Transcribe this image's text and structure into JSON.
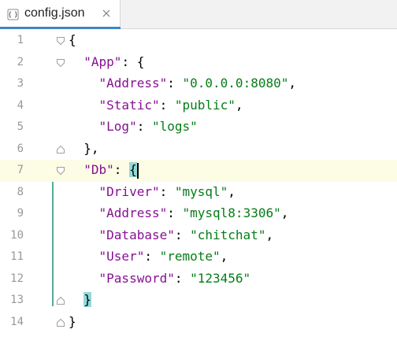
{
  "tab": {
    "title": "config.json",
    "icon": "json-file-icon",
    "close_icon": "close-icon",
    "accent": "#4083c9"
  },
  "colors": {
    "key": "#871094",
    "string": "#067d17",
    "current_line": "#fdfce5",
    "brace_highlight": "#93d9d9",
    "line_number": "#999999"
  },
  "editor": {
    "current_line": 7,
    "lines": [
      {
        "n": "1",
        "tokens": [
          {
            "t": "{",
            "c": "punc"
          }
        ]
      },
      {
        "n": "2",
        "tokens": [
          {
            "t": "  ",
            "c": "punc"
          },
          {
            "t": "\"App\"",
            "c": "key"
          },
          {
            "t": ": {",
            "c": "punc"
          }
        ]
      },
      {
        "n": "3",
        "tokens": [
          {
            "t": "    ",
            "c": "punc"
          },
          {
            "t": "\"Address\"",
            "c": "key"
          },
          {
            "t": ": ",
            "c": "punc"
          },
          {
            "t": "\"0.0.0.0:8080\"",
            "c": "str"
          },
          {
            "t": ",",
            "c": "punc"
          }
        ]
      },
      {
        "n": "4",
        "tokens": [
          {
            "t": "    ",
            "c": "punc"
          },
          {
            "t": "\"Static\"",
            "c": "key"
          },
          {
            "t": ": ",
            "c": "punc"
          },
          {
            "t": "\"public\"",
            "c": "str"
          },
          {
            "t": ",",
            "c": "punc"
          }
        ]
      },
      {
        "n": "5",
        "tokens": [
          {
            "t": "    ",
            "c": "punc"
          },
          {
            "t": "\"Log\"",
            "c": "key"
          },
          {
            "t": ": ",
            "c": "punc"
          },
          {
            "t": "\"logs\"",
            "c": "str"
          }
        ]
      },
      {
        "n": "6",
        "tokens": [
          {
            "t": "  },",
            "c": "punc"
          }
        ]
      },
      {
        "n": "7",
        "tokens": [
          {
            "t": "  ",
            "c": "punc"
          },
          {
            "t": "\"Db\"",
            "c": "key"
          },
          {
            "t": ": ",
            "c": "punc"
          },
          {
            "t": "{",
            "c": "brace"
          }
        ]
      },
      {
        "n": "8",
        "tokens": [
          {
            "t": "    ",
            "c": "punc"
          },
          {
            "t": "\"Driver\"",
            "c": "key"
          },
          {
            "t": ": ",
            "c": "punc"
          },
          {
            "t": "\"mysql\"",
            "c": "str"
          },
          {
            "t": ",",
            "c": "punc"
          }
        ]
      },
      {
        "n": "9",
        "tokens": [
          {
            "t": "    ",
            "c": "punc"
          },
          {
            "t": "\"Address\"",
            "c": "key"
          },
          {
            "t": ": ",
            "c": "punc"
          },
          {
            "t": "\"mysql8:3306\"",
            "c": "str"
          },
          {
            "t": ",",
            "c": "punc"
          }
        ]
      },
      {
        "n": "10",
        "tokens": [
          {
            "t": "    ",
            "c": "punc"
          },
          {
            "t": "\"Database\"",
            "c": "key"
          },
          {
            "t": ": ",
            "c": "punc"
          },
          {
            "t": "\"chitchat\"",
            "c": "str"
          },
          {
            "t": ",",
            "c": "punc"
          }
        ]
      },
      {
        "n": "11",
        "tokens": [
          {
            "t": "    ",
            "c": "punc"
          },
          {
            "t": "\"User\"",
            "c": "key"
          },
          {
            "t": ": ",
            "c": "punc"
          },
          {
            "t": "\"remote\"",
            "c": "str"
          },
          {
            "t": ",",
            "c": "punc"
          }
        ]
      },
      {
        "n": "12",
        "tokens": [
          {
            "t": "    ",
            "c": "punc"
          },
          {
            "t": "\"Password\"",
            "c": "key"
          },
          {
            "t": ": ",
            "c": "punc"
          },
          {
            "t": "\"123456\"",
            "c": "str"
          }
        ]
      },
      {
        "n": "13",
        "tokens": [
          {
            "t": "  ",
            "c": "punc"
          },
          {
            "t": "}",
            "c": "brace"
          }
        ]
      },
      {
        "n": "14",
        "tokens": [
          {
            "t": "}",
            "c": "punc"
          }
        ]
      }
    ],
    "fold_icons": [
      {
        "line": 1,
        "type": "open"
      },
      {
        "line": 2,
        "type": "open"
      },
      {
        "line": 6,
        "type": "close"
      },
      {
        "line": 7,
        "type": "open"
      },
      {
        "line": 13,
        "type": "close"
      },
      {
        "line": 14,
        "type": "close"
      }
    ]
  }
}
